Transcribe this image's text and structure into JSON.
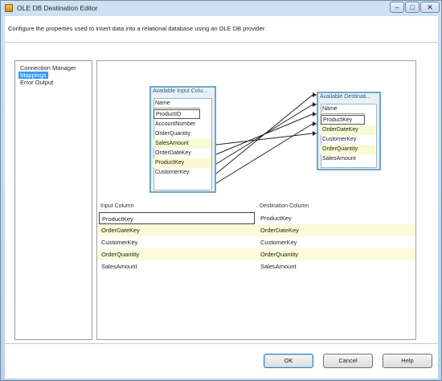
{
  "window": {
    "title": "OLE DB Destination Editor",
    "min": "–",
    "max": "□",
    "close": "✕"
  },
  "description": "Configure the properties used to insert data into a relational database using an OLE DB provider.",
  "nav": {
    "items": [
      "Connection Manager",
      "Mappings",
      "Error Output"
    ],
    "selected_index": 1
  },
  "input_table": {
    "title": "Available Input Colu...",
    "header": "Name",
    "columns": [
      "ProductID",
      "AccountNumber",
      "OrderQuantity",
      "SalesAmount",
      "OrderDateKey",
      "ProductKey",
      "CustomerKey"
    ]
  },
  "dest_table": {
    "title": "Available Destinati...",
    "header": "Name",
    "columns": [
      "ProductKey",
      "OrderDateKey",
      "CustomerKey",
      "OrderQuantity",
      "SalesAmount"
    ]
  },
  "mapping_grid": {
    "headers": {
      "input": "Input Column",
      "destination": "Destination Column"
    },
    "rows": [
      {
        "input": "ProductKey",
        "destination": "ProductKey"
      },
      {
        "input": "OrderDateKey",
        "destination": "OrderDateKey"
      },
      {
        "input": "CustomerKey",
        "destination": "CustomerKey"
      },
      {
        "input": "OrderQuantity",
        "destination": "OrderQuantity"
      },
      {
        "input": "SalesAmount",
        "destination": "SalesAmount"
      }
    ]
  },
  "buttons": {
    "ok": "OK",
    "cancel": "Cancel",
    "help": "Help"
  }
}
